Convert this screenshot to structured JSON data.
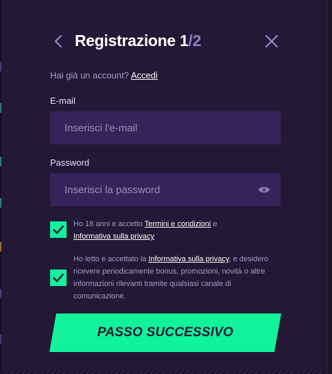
{
  "header": {
    "title_main": "Registrazione 1",
    "title_total": "/2"
  },
  "login_prompt": {
    "text": "Hai già un account?",
    "link": "Accedi"
  },
  "email": {
    "label": "E-mail",
    "placeholder": "Inserisci l'e-mail",
    "value": ""
  },
  "password": {
    "label": "Password",
    "placeholder": "Inserisci la password",
    "value": ""
  },
  "consent_age": {
    "checked": true,
    "text_1": "Ho 18 anni e accetto ",
    "link_terms": "Termini e condizioni",
    "text_2": " e",
    "link_privacy": "Informativa sulla privacy"
  },
  "consent_marketing": {
    "checked": true,
    "text_1": "Ho letto e accettato la ",
    "link_privacy": "Informativa sulla privacy",
    "text_2": ", e desidero ricevere periodicamente bonus, promozioni, novità o altre informazioni rilevanti tramite qualsiasi canale di comunicazione."
  },
  "cta": {
    "label": "PASSO SUCCESSIVO"
  },
  "colors": {
    "background": "#1a1328",
    "panel": "#231936",
    "input": "#35235a",
    "accent": "#12f29a",
    "title_step_total": "#8f7fc4"
  },
  "icons": {
    "back": "chevron-left-icon",
    "close": "close-icon",
    "password_toggle": "eye-icon",
    "checkbox": "checkmark-icon"
  }
}
